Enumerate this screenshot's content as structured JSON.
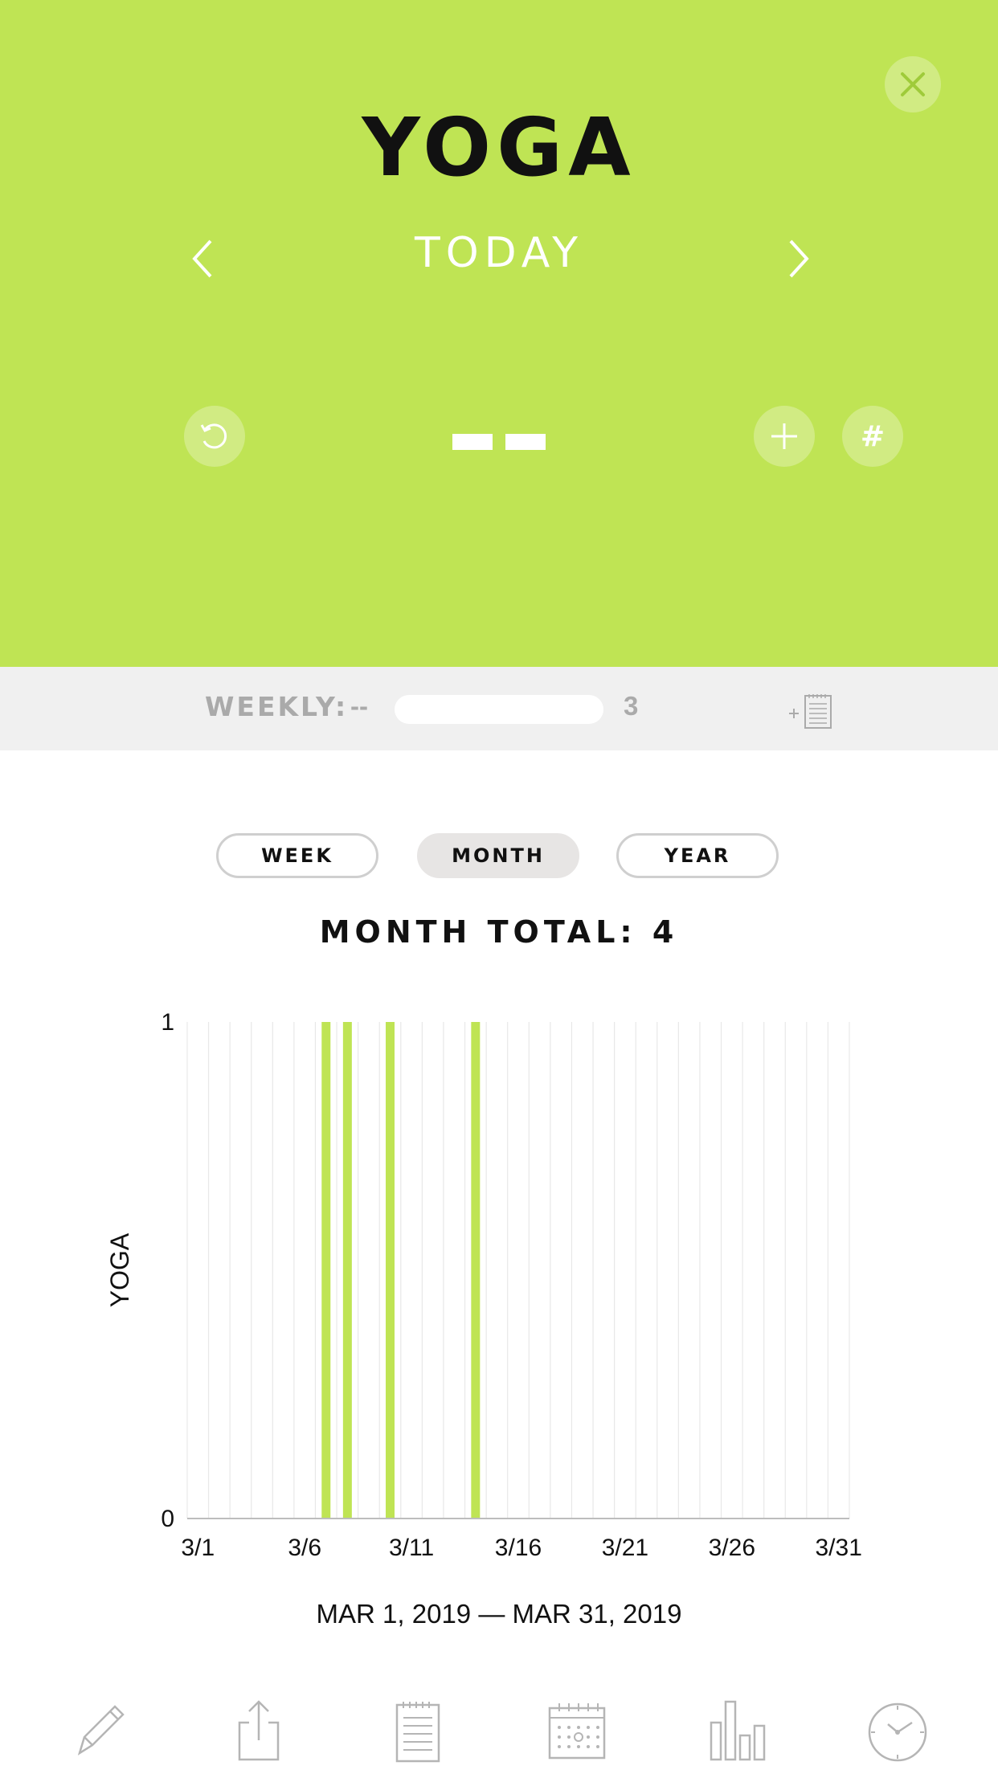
{
  "header": {
    "title": "YOGA",
    "period": "TODAY",
    "value": "--",
    "hash_label": "#",
    "close_icon": "close-icon",
    "accent": "#bfe454"
  },
  "weekly": {
    "label": "WEEKLY:",
    "current": "--",
    "goal": "3",
    "progress_fraction": 0
  },
  "segments": {
    "week": "WEEK",
    "month": "MONTH",
    "year": "YEAR",
    "selected": "MONTH"
  },
  "summary": {
    "total_text": "MONTH TOTAL: 4"
  },
  "chart_data": {
    "type": "bar",
    "ylabel": "YOGA",
    "ylim": [
      0,
      1
    ],
    "y_ticks": [
      "0",
      "1"
    ],
    "x_tick_labels": [
      "3/1",
      "3/6",
      "3/11",
      "3/16",
      "3/21",
      "3/26",
      "3/31"
    ],
    "x_tick_days": [
      1,
      6,
      11,
      16,
      21,
      26,
      31
    ],
    "days": [
      1,
      2,
      3,
      4,
      5,
      6,
      7,
      8,
      9,
      10,
      11,
      12,
      13,
      14,
      15,
      16,
      17,
      18,
      19,
      20,
      21,
      22,
      23,
      24,
      25,
      26,
      27,
      28,
      29,
      30,
      31
    ],
    "values": [
      0,
      0,
      0,
      0,
      0,
      0,
      1,
      1,
      0,
      1,
      0,
      0,
      0,
      1,
      0,
      0,
      0,
      0,
      0,
      0,
      0,
      0,
      0,
      0,
      0,
      0,
      0,
      0,
      0,
      0,
      0
    ],
    "bar_color": "#bfe454",
    "grid": true
  },
  "date_range": "MAR 1, 2019 — MAR 31, 2019",
  "tabbar": [
    "pencil-icon",
    "share-icon",
    "notes-icon",
    "calendar-icon",
    "bar-chart-icon",
    "clock-icon"
  ]
}
